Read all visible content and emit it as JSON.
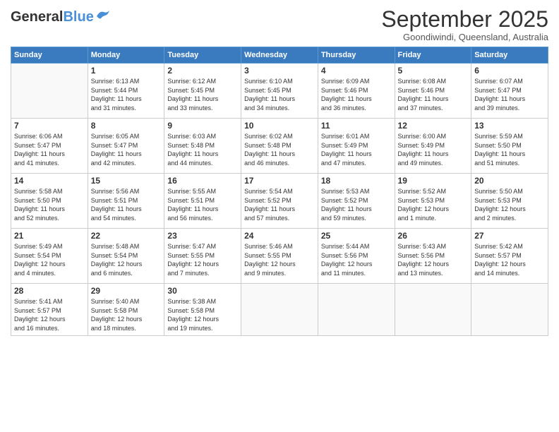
{
  "header": {
    "logo_general": "General",
    "logo_blue": "Blue",
    "month": "September 2025",
    "location": "Goondiwindi, Queensland, Australia"
  },
  "days_of_week": [
    "Sunday",
    "Monday",
    "Tuesday",
    "Wednesday",
    "Thursday",
    "Friday",
    "Saturday"
  ],
  "weeks": [
    [
      {
        "day": "",
        "info": ""
      },
      {
        "day": "1",
        "info": "Sunrise: 6:13 AM\nSunset: 5:44 PM\nDaylight: 11 hours\nand 31 minutes."
      },
      {
        "day": "2",
        "info": "Sunrise: 6:12 AM\nSunset: 5:45 PM\nDaylight: 11 hours\nand 33 minutes."
      },
      {
        "day": "3",
        "info": "Sunrise: 6:10 AM\nSunset: 5:45 PM\nDaylight: 11 hours\nand 34 minutes."
      },
      {
        "day": "4",
        "info": "Sunrise: 6:09 AM\nSunset: 5:46 PM\nDaylight: 11 hours\nand 36 minutes."
      },
      {
        "day": "5",
        "info": "Sunrise: 6:08 AM\nSunset: 5:46 PM\nDaylight: 11 hours\nand 37 minutes."
      },
      {
        "day": "6",
        "info": "Sunrise: 6:07 AM\nSunset: 5:47 PM\nDaylight: 11 hours\nand 39 minutes."
      }
    ],
    [
      {
        "day": "7",
        "info": "Sunrise: 6:06 AM\nSunset: 5:47 PM\nDaylight: 11 hours\nand 41 minutes."
      },
      {
        "day": "8",
        "info": "Sunrise: 6:05 AM\nSunset: 5:47 PM\nDaylight: 11 hours\nand 42 minutes."
      },
      {
        "day": "9",
        "info": "Sunrise: 6:03 AM\nSunset: 5:48 PM\nDaylight: 11 hours\nand 44 minutes."
      },
      {
        "day": "10",
        "info": "Sunrise: 6:02 AM\nSunset: 5:48 PM\nDaylight: 11 hours\nand 46 minutes."
      },
      {
        "day": "11",
        "info": "Sunrise: 6:01 AM\nSunset: 5:49 PM\nDaylight: 11 hours\nand 47 minutes."
      },
      {
        "day": "12",
        "info": "Sunrise: 6:00 AM\nSunset: 5:49 PM\nDaylight: 11 hours\nand 49 minutes."
      },
      {
        "day": "13",
        "info": "Sunrise: 5:59 AM\nSunset: 5:50 PM\nDaylight: 11 hours\nand 51 minutes."
      }
    ],
    [
      {
        "day": "14",
        "info": "Sunrise: 5:58 AM\nSunset: 5:50 PM\nDaylight: 11 hours\nand 52 minutes."
      },
      {
        "day": "15",
        "info": "Sunrise: 5:56 AM\nSunset: 5:51 PM\nDaylight: 11 hours\nand 54 minutes."
      },
      {
        "day": "16",
        "info": "Sunrise: 5:55 AM\nSunset: 5:51 PM\nDaylight: 11 hours\nand 56 minutes."
      },
      {
        "day": "17",
        "info": "Sunrise: 5:54 AM\nSunset: 5:52 PM\nDaylight: 11 hours\nand 57 minutes."
      },
      {
        "day": "18",
        "info": "Sunrise: 5:53 AM\nSunset: 5:52 PM\nDaylight: 11 hours\nand 59 minutes."
      },
      {
        "day": "19",
        "info": "Sunrise: 5:52 AM\nSunset: 5:53 PM\nDaylight: 12 hours\nand 1 minute."
      },
      {
        "day": "20",
        "info": "Sunrise: 5:50 AM\nSunset: 5:53 PM\nDaylight: 12 hours\nand 2 minutes."
      }
    ],
    [
      {
        "day": "21",
        "info": "Sunrise: 5:49 AM\nSunset: 5:54 PM\nDaylight: 12 hours\nand 4 minutes."
      },
      {
        "day": "22",
        "info": "Sunrise: 5:48 AM\nSunset: 5:54 PM\nDaylight: 12 hours\nand 6 minutes."
      },
      {
        "day": "23",
        "info": "Sunrise: 5:47 AM\nSunset: 5:55 PM\nDaylight: 12 hours\nand 7 minutes."
      },
      {
        "day": "24",
        "info": "Sunrise: 5:46 AM\nSunset: 5:55 PM\nDaylight: 12 hours\nand 9 minutes."
      },
      {
        "day": "25",
        "info": "Sunrise: 5:44 AM\nSunset: 5:56 PM\nDaylight: 12 hours\nand 11 minutes."
      },
      {
        "day": "26",
        "info": "Sunrise: 5:43 AM\nSunset: 5:56 PM\nDaylight: 12 hours\nand 13 minutes."
      },
      {
        "day": "27",
        "info": "Sunrise: 5:42 AM\nSunset: 5:57 PM\nDaylight: 12 hours\nand 14 minutes."
      }
    ],
    [
      {
        "day": "28",
        "info": "Sunrise: 5:41 AM\nSunset: 5:57 PM\nDaylight: 12 hours\nand 16 minutes."
      },
      {
        "day": "29",
        "info": "Sunrise: 5:40 AM\nSunset: 5:58 PM\nDaylight: 12 hours\nand 18 minutes."
      },
      {
        "day": "30",
        "info": "Sunrise: 5:38 AM\nSunset: 5:58 PM\nDaylight: 12 hours\nand 19 minutes."
      },
      {
        "day": "",
        "info": ""
      },
      {
        "day": "",
        "info": ""
      },
      {
        "day": "",
        "info": ""
      },
      {
        "day": "",
        "info": ""
      }
    ]
  ]
}
